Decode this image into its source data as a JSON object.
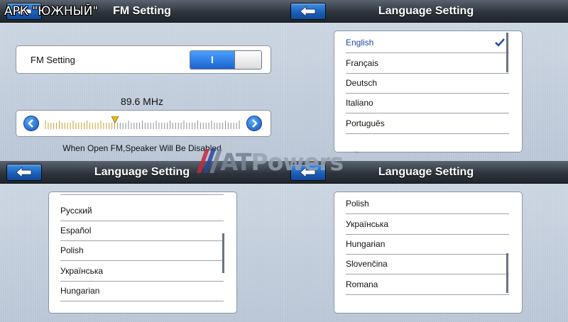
{
  "watermark": "АРК \"ЮЖНЫЙ\"",
  "logo": {
    "first": "AT",
    "rest": "Powers",
    "mark": "™"
  },
  "fm_panel": {
    "title": "FM Setting",
    "fm_label": "FM Setting",
    "toggle_on_label": "I",
    "frequency": "89.6 MHz",
    "slider_level": 0.36,
    "note": "When Open FM,Speaker Will Be Disabled"
  },
  "lang_panel_1": {
    "title": "Language Setting",
    "items": [
      "English",
      "Français",
      "Deutsch",
      "Italiano",
      "Português"
    ],
    "selected": "English"
  },
  "lang_panel_2": {
    "title": "Language Setting",
    "items": [
      "Русский",
      "Español",
      "Polish",
      "Українська",
      "Hungarian"
    ]
  },
  "lang_panel_3": {
    "title": "Language Setting",
    "items": [
      "Polish",
      "Українська",
      "Hungarian",
      "Slovenčina",
      "Romana"
    ]
  },
  "icons": {
    "back": "back-arrow-icon",
    "prev": "left-arrow-icon",
    "next": "right-arrow-icon",
    "check": "check-icon"
  },
  "colors": {
    "accent": "#1b64d0",
    "header": "#2e353d",
    "selected_text": "#1a46a0"
  }
}
